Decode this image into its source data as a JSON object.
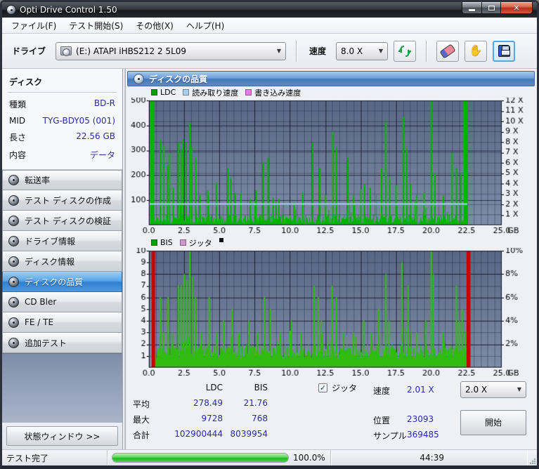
{
  "window": {
    "title": "Opti Drive Control 1.50"
  },
  "menu": {
    "items": [
      "ファイル(F)",
      "テスト開始(S)",
      "その他(X)",
      "ヘルプ(H)"
    ]
  },
  "toolbar": {
    "drive_label": "ドライブ",
    "drive_value": "(E:)   ATAPI iHBS212   2 5L09",
    "speed_label": "速度",
    "speed_value": "8.0 X",
    "icons": [
      "drive-icon",
      "refresh-icon",
      "eraser-icon",
      "hand-icon",
      "save-icon"
    ]
  },
  "sidebar": {
    "disc_header": "ディスク",
    "info": [
      {
        "label": "種類",
        "value": "BD-R"
      },
      {
        "label": "MID",
        "value": "TYG-BDY05 (001)"
      },
      {
        "label": "長さ",
        "value": "22.56 GB"
      },
      {
        "label": "内容",
        "value": "データ"
      }
    ],
    "buttons": [
      {
        "label": "転送率"
      },
      {
        "label": "テスト ディスクの作成"
      },
      {
        "label": "テスト ディスクの検証"
      },
      {
        "label": "ドライブ情報"
      },
      {
        "label": "ディスク情報"
      },
      {
        "label": "ディスクの品質",
        "selected": true
      },
      {
        "label": "CD Bler"
      },
      {
        "label": "FE / TE"
      },
      {
        "label": "追加テスト"
      }
    ],
    "status_window_button": "状態ウィンドウ >>"
  },
  "main": {
    "header": "ディスクの品質"
  },
  "stats": {
    "col_headers": [
      "LDC",
      "BIS"
    ],
    "rows": [
      {
        "label": "平均",
        "ldc": "278.49",
        "bis": "21.76"
      },
      {
        "label": "最大",
        "ldc": "9728",
        "bis": "768"
      },
      {
        "label": "合計",
        "ldc": "102900444",
        "bis": "8039954"
      }
    ],
    "jitter_checkbox_label": "ジッタ",
    "jitter_checked": "✓",
    "speed_label": "速度",
    "speed_value": "2.01 X",
    "speed_select_value": "2.0 X",
    "position_label": "位置",
    "position_value": "23093",
    "samples_label": "サンプル",
    "samples_value": "369485",
    "start_button": "開始"
  },
  "statusbar": {
    "status": "テスト完了",
    "progress_percent": "100.0%",
    "progress_value": 100,
    "time": "44:39"
  },
  "chart_data": [
    {
      "type": "bar",
      "title": "ディスクの品質 — LDC / 読み取り速度",
      "series": [
        {
          "name": "LDC",
          "color": "#00a400"
        },
        {
          "name": "読み取り速度",
          "color": "#a8d0ec"
        },
        {
          "name": "書き込み速度",
          "color": "#e87ae8"
        }
      ],
      "xlim": [
        0,
        25
      ],
      "ylim_left": [
        0,
        500
      ],
      "ylim_right": [
        0,
        12
      ],
      "x_unit": "GB",
      "xticks": [
        "0.0",
        "2.5",
        "5.0",
        "7.5",
        "10.0",
        "12.5",
        "15.0",
        "17.5",
        "20.0",
        "22.5",
        "25.0"
      ],
      "yticks_left": [
        {
          "v": 500,
          "label": "500"
        },
        {
          "v": 400,
          "label": "400"
        },
        {
          "v": 300,
          "label": "300"
        },
        {
          "v": 200,
          "label": "200"
        },
        {
          "v": 100,
          "label": "100"
        }
      ],
      "yticks_right": [
        {
          "v": 12,
          "label": "12 X"
        },
        {
          "v": 11,
          "label": "11 X"
        },
        {
          "v": 10,
          "label": "10 X"
        },
        {
          "v": 9,
          "label": "9 X"
        },
        {
          "v": 8,
          "label": "8 X"
        },
        {
          "v": 7,
          "label": "7 X"
        },
        {
          "v": 6,
          "label": "6 X"
        },
        {
          "v": 5,
          "label": "5 X"
        },
        {
          "v": 4,
          "label": "4 X"
        },
        {
          "v": 3,
          "label": "3 X"
        },
        {
          "v": 2,
          "label": "2 X"
        },
        {
          "v": 1,
          "label": "1 X"
        }
      ],
      "grid": {
        "x_minor": 0.5,
        "x_major": 2.5,
        "y_minor": 41.6667,
        "y_major": 100
      },
      "data_range": [
        0.12,
        22.56
      ],
      "seed": 13,
      "baseline": {
        "min": 6,
        "max": 42,
        "spike_chance": 0.08,
        "spike_extra": 100
      },
      "spikes": [
        [
          0.8,
          345
        ],
        [
          1.05,
          320
        ],
        [
          1.3,
          240
        ],
        [
          1.5,
          290
        ],
        [
          1.75,
          150
        ],
        [
          2.1,
          330
        ],
        [
          2.3,
          305
        ],
        [
          2.45,
          345
        ],
        [
          2.65,
          335
        ],
        [
          2.9,
          410
        ],
        [
          3.05,
          315
        ],
        [
          3.3,
          270
        ],
        [
          3.6,
          120
        ],
        [
          4.2,
          140
        ],
        [
          4.8,
          170
        ],
        [
          5.6,
          230
        ],
        [
          5.8,
          190
        ],
        [
          6.1,
          130
        ],
        [
          6.5,
          125
        ],
        [
          7.2,
          105
        ],
        [
          7.6,
          140
        ],
        [
          8.1,
          250
        ],
        [
          8.45,
          270
        ],
        [
          8.8,
          110
        ],
        [
          9.2,
          105
        ],
        [
          10.3,
          90
        ],
        [
          10.9,
          130
        ],
        [
          11.6,
          330
        ],
        [
          12.1,
          230
        ],
        [
          12.5,
          120
        ],
        [
          13.05,
          375
        ],
        [
          13.3,
          310
        ],
        [
          14.1,
          270
        ],
        [
          14.5,
          120
        ],
        [
          15.0,
          145
        ],
        [
          15.3,
          165
        ],
        [
          15.7,
          150
        ],
        [
          16.5,
          230
        ],
        [
          16.8,
          415
        ],
        [
          17.05,
          190
        ],
        [
          17.5,
          160
        ],
        [
          18.0,
          435
        ],
        [
          18.3,
          310
        ],
        [
          18.55,
          165
        ],
        [
          19.0,
          120
        ],
        [
          19.5,
          130
        ],
        [
          20.0,
          500
        ],
        [
          20.25,
          210
        ],
        [
          20.9,
          120
        ],
        [
          21.5,
          290
        ],
        [
          21.8,
          230
        ],
        [
          22.1,
          210
        ]
      ],
      "full_bars": [
        {
          "x": 0.12,
          "w": 0.28,
          "color": "#00b400"
        },
        {
          "x": 22.28,
          "w": 0.3,
          "color": "#00b400"
        }
      ],
      "hline": {
        "value": 85,
        "color": "#a8d8f8",
        "note": "read speed ~2X"
      },
      "colors": {
        "bar": "#00b400",
        "plot_top": "#596786",
        "plot_bottom": "#7e8ca8",
        "grid_minor": "rgba(22,28,46,0.35)",
        "grid_major": "rgba(8,10,20,0.62)"
      }
    },
    {
      "type": "bar",
      "title": "ディスクの品質 — BIS / ジッタ",
      "series": [
        {
          "name": "BIS",
          "color": "#00a400"
        },
        {
          "name": "ジッタ",
          "color": "#cc99cc"
        }
      ],
      "legend_marker": "▪",
      "xlim": [
        0,
        25
      ],
      "ylim_left": [
        0,
        10
      ],
      "ylim_right": [
        0,
        10
      ],
      "x_unit": "GB",
      "xticks": [
        "0.0",
        "2.5",
        "5.0",
        "7.5",
        "10.0",
        "12.5",
        "15.0",
        "17.5",
        "20.0",
        "22.5",
        "25.0"
      ],
      "yticks_left": [
        {
          "v": 10,
          "label": "10"
        },
        {
          "v": 9,
          "label": "9"
        },
        {
          "v": 8,
          "label": "8"
        },
        {
          "v": 7,
          "label": "7"
        },
        {
          "v": 6,
          "label": "6"
        },
        {
          "v": 5,
          "label": "5"
        },
        {
          "v": 4,
          "label": "4"
        },
        {
          "v": 3,
          "label": "3"
        },
        {
          "v": 2,
          "label": "2"
        },
        {
          "v": 1,
          "label": "1"
        }
      ],
      "yticks_right": [
        {
          "v": 10,
          "label": "10%"
        },
        {
          "v": 8,
          "label": "8%"
        },
        {
          "v": 6,
          "label": "6%"
        },
        {
          "v": 4,
          "label": "4%"
        },
        {
          "v": 2,
          "label": "2%"
        }
      ],
      "grid": {
        "x_minor": 0.5,
        "x_major": 2.5,
        "y_minor": 1,
        "y_major": 2
      },
      "data_range": [
        0.42,
        22.5
      ],
      "seed": 99,
      "baseline": {
        "min": 0.8,
        "max": 2.0,
        "spike_chance": 0.14,
        "spike_extra": 1.6
      },
      "spikes": [
        [
          0.8,
          6
        ],
        [
          1.0,
          3
        ],
        [
          1.4,
          6
        ],
        [
          1.7,
          3
        ],
        [
          2.1,
          7
        ],
        [
          2.3,
          7
        ],
        [
          2.5,
          8
        ],
        [
          2.7,
          7.5
        ],
        [
          2.9,
          10
        ],
        [
          3.1,
          7.8
        ],
        [
          3.3,
          6
        ],
        [
          3.7,
          3
        ],
        [
          4.3,
          6
        ],
        [
          4.8,
          3
        ],
        [
          5.3,
          4
        ],
        [
          5.9,
          5
        ],
        [
          6.4,
          3
        ],
        [
          7.1,
          4
        ],
        [
          7.7,
          3
        ],
        [
          8.2,
          6
        ],
        [
          8.6,
          5
        ],
        [
          9.3,
          3
        ],
        [
          10.1,
          4
        ],
        [
          10.8,
          3
        ],
        [
          11.7,
          7
        ],
        [
          12.0,
          6
        ],
        [
          12.2,
          4
        ],
        [
          13.0,
          7
        ],
        [
          13.3,
          6
        ],
        [
          13.8,
          3
        ],
        [
          14.5,
          3
        ],
        [
          15.2,
          4
        ],
        [
          15.8,
          3
        ],
        [
          16.3,
          5
        ],
        [
          16.8,
          8
        ],
        [
          17.0,
          4
        ],
        [
          17.9,
          9
        ],
        [
          18.4,
          7
        ],
        [
          19.0,
          3
        ],
        [
          19.6,
          4
        ],
        [
          20.0,
          10
        ],
        [
          20.15,
          8
        ],
        [
          20.8,
          3
        ],
        [
          21.8,
          7
        ],
        [
          22.0,
          4
        ],
        [
          22.2,
          5
        ]
      ],
      "full_bars": [
        {
          "x": 0.18,
          "w": 0.24,
          "color": "#cc0000"
        },
        {
          "x": 22.5,
          "w": 0.28,
          "color": "#cc0000"
        }
      ],
      "colors": {
        "bar": "#2fbb11",
        "plot_top": "#596786",
        "plot_bottom": "#7e8ca8",
        "grid_minor": "rgba(22,28,46,0.35)",
        "grid_major": "rgba(8,10,20,0.62)"
      }
    }
  ]
}
